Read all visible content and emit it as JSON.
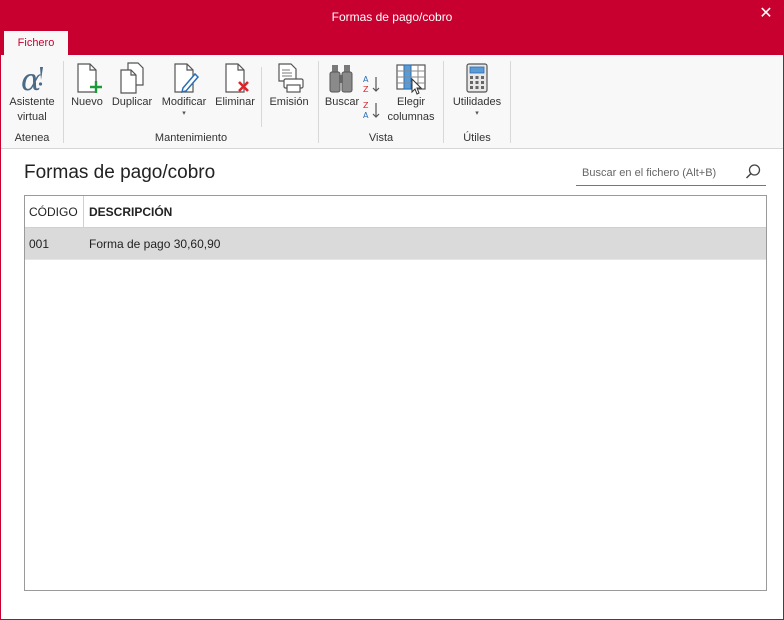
{
  "window": {
    "title": "Formas de pago/cobro",
    "close_label": "✕",
    "accent": "#c8002f"
  },
  "ribbon": {
    "tab": "Fichero",
    "groups": {
      "atenea": {
        "label": "Atenea",
        "asistente": {
          "line1": "Asistente",
          "line2": "virtual",
          "icon": "alpha-icon"
        }
      },
      "mantenimiento": {
        "label": "Mantenimiento",
        "nuevo": {
          "label": "Nuevo",
          "icon": "new-document-icon"
        },
        "duplicar": {
          "label": "Duplicar",
          "icon": "duplicate-icon"
        },
        "modificar": {
          "label": "Modificar",
          "icon": "edit-document-icon",
          "dropdown": "▾"
        },
        "eliminar": {
          "label": "Eliminar",
          "icon": "delete-document-icon"
        },
        "emision": {
          "label": "Emisión",
          "icon": "print-icon"
        }
      },
      "vista": {
        "label": "Vista",
        "buscar": {
          "label": "Buscar",
          "icon": "binoculars-icon"
        },
        "elegir": {
          "line1": "Elegir",
          "line2": "columnas",
          "icon": "columns-icon"
        }
      },
      "utiles": {
        "label": "Útiles",
        "utilidades": {
          "label": "Utilidades",
          "icon": "calculator-icon",
          "dropdown": "▾"
        }
      }
    }
  },
  "main": {
    "title": "Formas de pago/cobro",
    "search": {
      "placeholder": "Buscar en el fichero (Alt+B)",
      "value": ""
    },
    "table": {
      "columns": [
        "CÓDIGO",
        "DESCRIPCIÓN"
      ],
      "rows": [
        {
          "codigo": "001",
          "descripcion": "Forma de pago 30,60,90"
        }
      ],
      "selected_row_color": "#dadada"
    }
  }
}
